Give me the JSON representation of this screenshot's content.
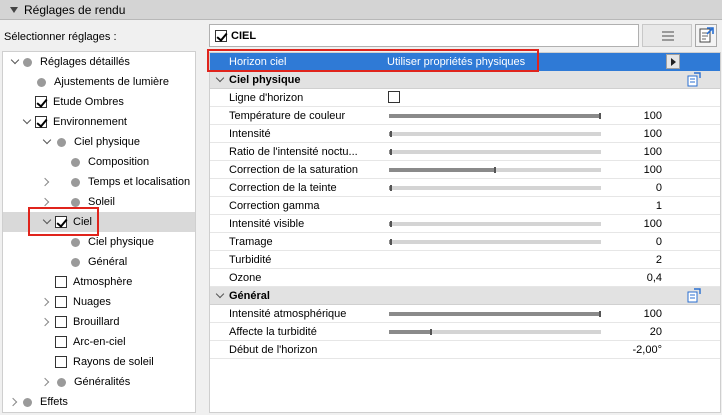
{
  "panel": {
    "title": "Réglages de rendu"
  },
  "left": {
    "label": "Sélectionner réglages :"
  },
  "tree": [
    {
      "label": "Réglages détaillés",
      "indent": 0,
      "twisty": "down",
      "marker": "dot",
      "checked": false,
      "selected": false
    },
    {
      "label": "Ajustements de lumière",
      "indent": 1,
      "twisty": "none",
      "marker": "dot",
      "checked": false,
      "selected": false
    },
    {
      "label": "Etude Ombres",
      "indent": 1,
      "twisty": "none",
      "marker": "checkbox",
      "checked": true,
      "selected": false
    },
    {
      "label": "Environnement",
      "indent": 1,
      "twisty": "down",
      "marker": "checkbox",
      "checked": true,
      "selected": false
    },
    {
      "label": "Ciel physique",
      "indent": 2,
      "twisty": "down",
      "marker": "dot",
      "checked": false,
      "selected": false
    },
    {
      "label": "Composition",
      "indent": 3,
      "twisty": "none",
      "marker": "dot",
      "checked": false,
      "selected": false
    },
    {
      "label": "Temps et localisation",
      "indent": 3,
      "twisty": "right",
      "marker": "dot",
      "checked": false,
      "selected": false
    },
    {
      "label": "Soleil",
      "indent": 3,
      "twisty": "right",
      "marker": "dot",
      "checked": false,
      "selected": false
    },
    {
      "label": "Ciel",
      "indent": 2,
      "twisty": "down",
      "marker": "checkbox",
      "checked": true,
      "selected": true
    },
    {
      "label": "Ciel physique",
      "indent": 3,
      "twisty": "none",
      "marker": "dot",
      "checked": false,
      "selected": false
    },
    {
      "label": "Général",
      "indent": 3,
      "twisty": "none",
      "marker": "dot",
      "checked": false,
      "selected": false
    },
    {
      "label": "Atmosphère",
      "indent": 2,
      "twisty": "none",
      "marker": "checkbox",
      "checked": false,
      "selected": false
    },
    {
      "label": "Nuages",
      "indent": 2,
      "twisty": "right",
      "marker": "checkbox",
      "checked": false,
      "selected": false
    },
    {
      "label": "Brouillard",
      "indent": 2,
      "twisty": "right",
      "marker": "checkbox",
      "checked": false,
      "selected": false
    },
    {
      "label": "Arc-en-ciel",
      "indent": 2,
      "twisty": "none",
      "marker": "checkbox",
      "checked": false,
      "selected": false
    },
    {
      "label": "Rayons de soleil",
      "indent": 2,
      "twisty": "none",
      "marker": "checkbox",
      "checked": false,
      "selected": false
    },
    {
      "label": "Généralités",
      "indent": 2,
      "twisty": "right",
      "marker": "dot",
      "checked": false,
      "selected": false
    },
    {
      "label": "Effets",
      "indent": 0,
      "twisty": "right",
      "marker": "dot",
      "checked": false,
      "selected": false
    }
  ],
  "header": {
    "label": "CIEL",
    "checked": true
  },
  "top_row": {
    "name": "Horizon ciel",
    "value": "Utiliser propriétés physiques"
  },
  "sections": [
    {
      "title": "Ciel physique",
      "rows": [
        {
          "name": "Ligne d'horizon",
          "type": "checkbox",
          "checked": false
        },
        {
          "name": "Température de couleur",
          "type": "slider",
          "value": "100",
          "level": 1.0
        },
        {
          "name": "Intensité",
          "type": "slider",
          "value": "100",
          "level": 0.01
        },
        {
          "name": "Ratio  de l'intensité noctu...",
          "type": "slider",
          "value": "100",
          "level": 0.01
        },
        {
          "name": "Correction de la saturation",
          "type": "slider",
          "value": "100",
          "level": 0.5
        },
        {
          "name": "Correction de la  teinte",
          "type": "slider",
          "value": "0",
          "level": 0.0
        },
        {
          "name": "Correction gamma",
          "type": "value",
          "value": "1"
        },
        {
          "name": "Intensité visible",
          "type": "slider",
          "value": "100",
          "level": 0.01
        },
        {
          "name": "Tramage",
          "type": "slider",
          "value": "0",
          "level": 0.0
        },
        {
          "name": "Turbidité",
          "type": "value",
          "value": "2"
        },
        {
          "name": "Ozone",
          "type": "value",
          "value": "0,4"
        }
      ]
    },
    {
      "title": "Général",
      "rows": [
        {
          "name": "Intensité atmosphérique",
          "type": "slider",
          "value": "100",
          "level": 1.0
        },
        {
          "name": "Affecte la turbidité",
          "type": "slider",
          "value": "20",
          "level": 0.2
        },
        {
          "name": "Début de l'horizon",
          "type": "value",
          "value": "-2,00°"
        }
      ]
    }
  ]
}
